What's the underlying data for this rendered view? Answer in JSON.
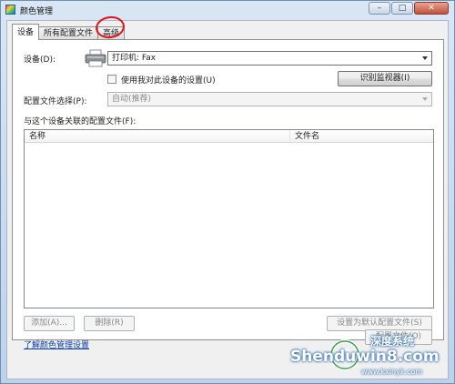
{
  "window": {
    "title": "颜色管理",
    "minimize": "–",
    "maximize": "□",
    "close": "✕"
  },
  "tabs": [
    {
      "label": "设备",
      "active": true
    },
    {
      "label": "所有配置文件",
      "active": false
    },
    {
      "label": "高级",
      "active": false
    }
  ],
  "device": {
    "label": "设备(D):",
    "selected": "打印机: Fax",
    "use_my_settings_label": "使用我对此设备的设置(U)",
    "use_my_settings_checked": false,
    "identify_monitors_button": "识别监视器(I)",
    "profile_selection_label": "配置文件选择(P):",
    "profile_selection_value": "自动(推荐)",
    "associated_profiles_label": "与这个设备关联的配置文件(F):"
  },
  "profiles_table": {
    "columns": [
      "名称",
      "文件名"
    ],
    "rows": []
  },
  "actions": {
    "add": "添加(A)...",
    "remove": "删除(R)",
    "set_default": "设置为默认配置文件(S)"
  },
  "footer": {
    "learn_link": "了解颜色管理设置",
    "profiles_button": "配置文件(O)"
  },
  "watermark": {
    "brand": "Shenduwin8.com",
    "url": "www.kxinyk.com",
    "chinese": "深度系统"
  }
}
